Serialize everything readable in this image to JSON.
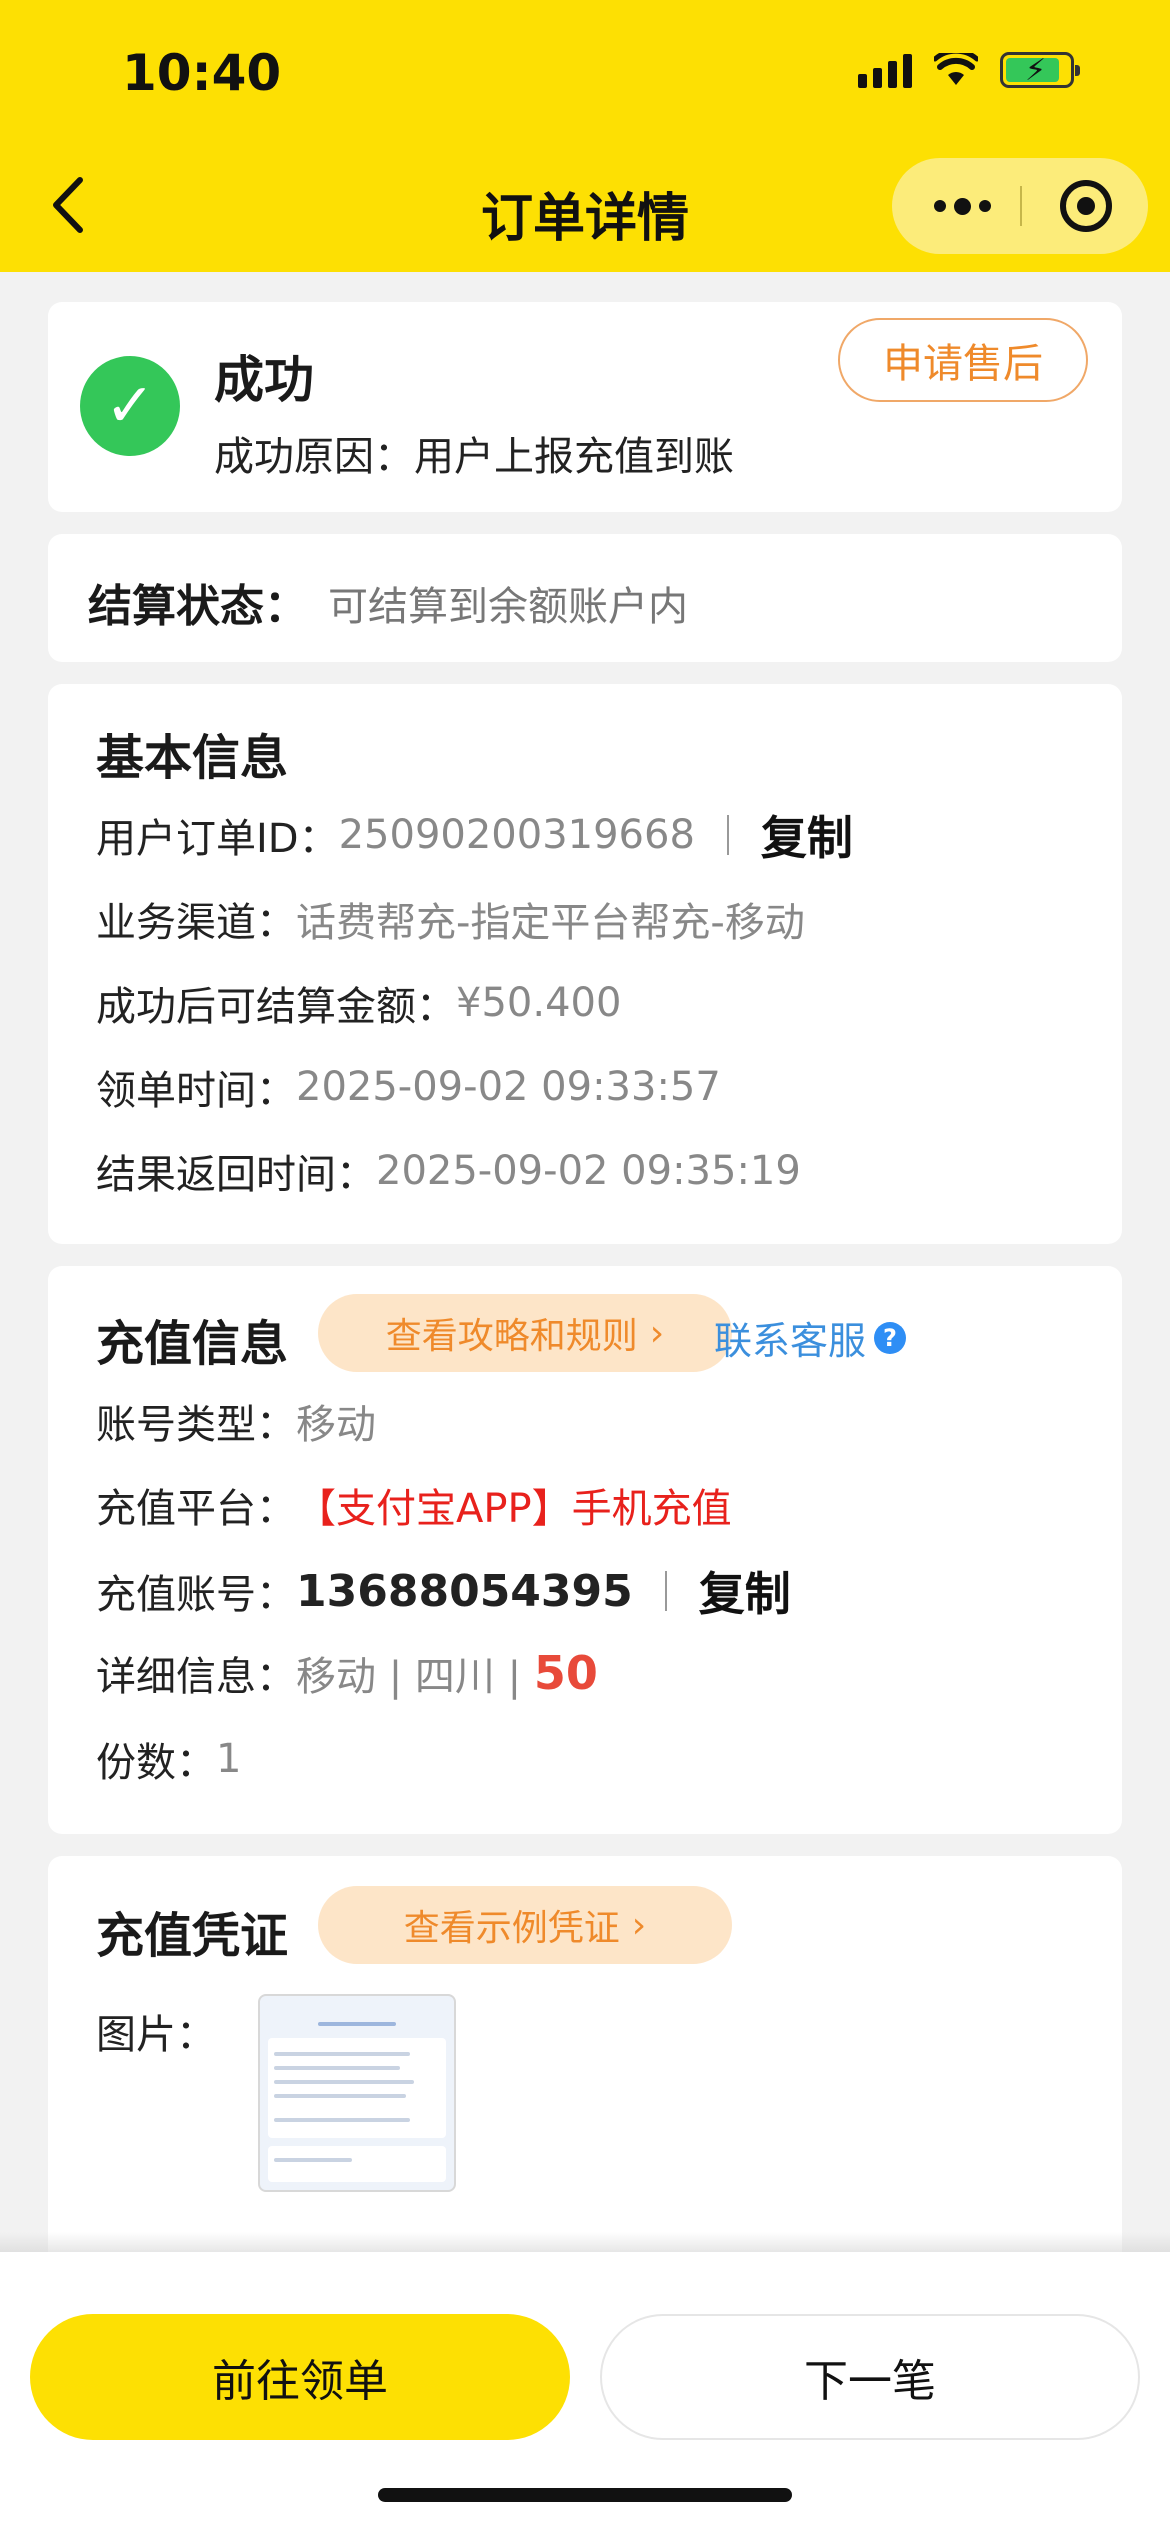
{
  "status_bar": {
    "time": "10:40"
  },
  "nav": {
    "title": "订单详情"
  },
  "result": {
    "title": "成功",
    "reason": "成功原因：用户上报充值到账",
    "after_sale_label": "申请售后"
  },
  "settlement": {
    "label": "结算状态：",
    "value": "可结算到余额账户内"
  },
  "basic_info": {
    "title": "基本信息",
    "order_id_label": "用户订单ID：",
    "order_id_value": "25090200319668",
    "copy_label": "复制",
    "channel_label": "业务渠道：",
    "channel_value": "话费帮充-指定平台帮充-移动",
    "amount_label": "成功后可结算金额：",
    "amount_value": "¥50.400",
    "claim_time_label": "领单时间：",
    "claim_time_value": "2025-09-02 09:33:57",
    "return_time_label": "结果返回时间：",
    "return_time_value": "2025-09-02 09:35:19"
  },
  "recharge_info": {
    "title": "充值信息",
    "guide_label": "查看攻略和规则",
    "service_label": "联系客服",
    "account_type_label": "账号类型：",
    "account_type_value": "移动",
    "platform_label": "充值平台：",
    "platform_value": "【支付宝APP】手机充值",
    "account_label": "充值账号：",
    "account_value": "13688054395",
    "copy_label": "复制",
    "detail_label": "详细信息：",
    "detail_value": "移动 | 四川 | ",
    "detail_amount": "50",
    "count_label": "份数：",
    "count_value": "1"
  },
  "voucher": {
    "title": "充值凭证",
    "example_label": "查看示例凭证",
    "image_label": "图片："
  },
  "bottom": {
    "primary_label": "前往领单",
    "secondary_label": "下一笔"
  },
  "colors": {
    "brand_yellow": "#fde003",
    "success_green": "#34c759",
    "accent_orange": "#ef8a2b",
    "link_blue": "#3b8fdd",
    "alert_red": "#e8211c"
  }
}
